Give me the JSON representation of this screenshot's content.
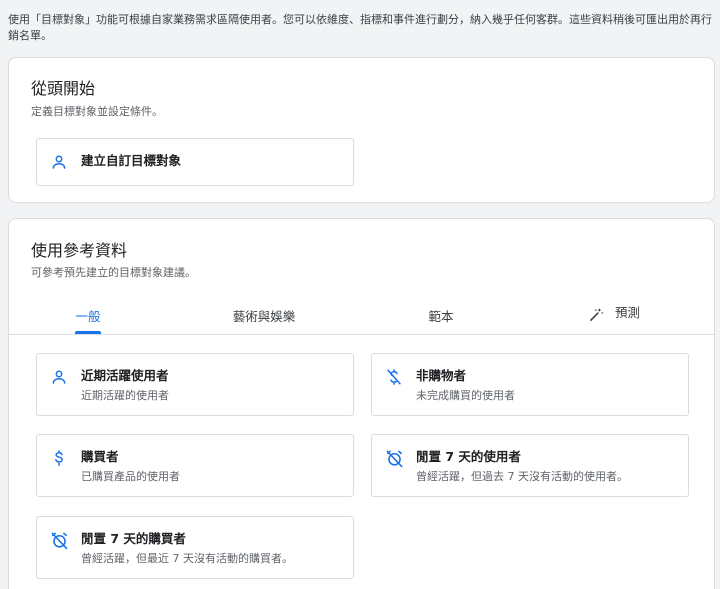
{
  "intro_text": "使用「目標對象」功能可根據自家業務需求區隔使用者。您可以依維度、指標和事件進行劃分，納入幾乎任何客群。這些資料稍後可匯出用於再行銷名單。",
  "scratch": {
    "title": "從頭開始",
    "subtitle": "定義目標對象並設定條件。",
    "custom_button": {
      "label": "建立自訂目標對象",
      "icon": "person-icon"
    }
  },
  "reference": {
    "title": "使用參考資料",
    "subtitle": "可參考預先建立的目標對象建議。",
    "tabs": [
      {
        "label": "一般",
        "active": true
      },
      {
        "label": "藝術與娛樂",
        "active": false
      },
      {
        "label": "範本",
        "active": false
      },
      {
        "label": "預測",
        "active": false,
        "icon": "magic-wand-icon"
      }
    ],
    "suggestions": [
      {
        "title": "近期活躍使用者",
        "description": "近期活躍的使用者",
        "icon": "person-icon"
      },
      {
        "title": "非購物者",
        "description": "未完成購買的使用者",
        "icon": "money-off-icon"
      },
      {
        "title": "購買者",
        "description": "已購買產品的使用者",
        "icon": "dollar-icon"
      },
      {
        "title": "閒置 7 天的使用者",
        "description": "曾經活躍，但過去 7 天沒有活動的使用者。",
        "icon": "alarm-off-icon"
      },
      {
        "title": "閒置 7 天的購買者",
        "description": "曾經活躍，但最近 7 天沒有活動的購買者。",
        "icon": "alarm-off-icon"
      }
    ]
  },
  "colors": {
    "accent": "#1a73e8",
    "background": "#f1f3f4",
    "border": "#dadce0"
  }
}
